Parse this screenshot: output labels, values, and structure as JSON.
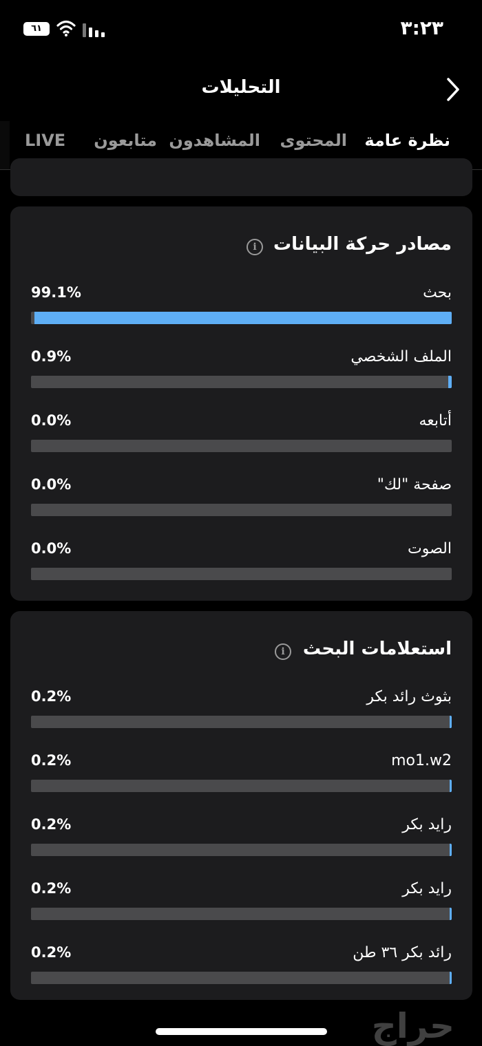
{
  "status_bar": {
    "time": "٣:٢٣",
    "battery_level": "٦١"
  },
  "header": {
    "title": "التحليلات"
  },
  "tabs": [
    {
      "label": "نظرة عامة",
      "active": true
    },
    {
      "label": "المحتوى",
      "active": false
    },
    {
      "label": "المشاهدون",
      "active": false
    },
    {
      "label": "متابعون",
      "active": false
    },
    {
      "label": "LIVE",
      "active": false
    }
  ],
  "traffic_sources": {
    "title": "مصادر حركة البيانات",
    "rows": [
      {
        "label": "بحث",
        "percent_text": "99.1%",
        "value": 99.1
      },
      {
        "label": "الملف الشخصي",
        "percent_text": "0.9%",
        "value": 0.9
      },
      {
        "label": "أتابعه",
        "percent_text": "0.0%",
        "value": 0.0
      },
      {
        "label": "صفحة \"لك\"",
        "percent_text": "0.0%",
        "value": 0.0
      },
      {
        "label": "الصوت",
        "percent_text": "0.0%",
        "value": 0.0
      }
    ]
  },
  "search_queries": {
    "title": "استعلامات البحث",
    "rows": [
      {
        "label": "بثوث رائد بكر",
        "percent_text": "0.2%",
        "value": 0.2
      },
      {
        "label": "mo1.w2",
        "percent_text": "0.2%",
        "value": 0.2
      },
      {
        "label": "رايد بكر",
        "percent_text": "0.2%",
        "value": 0.2
      },
      {
        "label": "رايد بكر",
        "percent_text": "0.2%",
        "value": 0.2
      },
      {
        "label": "رائد بكر ٣٦ طن",
        "percent_text": "0.2%",
        "value": 0.2
      }
    ]
  },
  "watermark": "حراج",
  "colors": {
    "accent": "#5eaef5",
    "card": "#1c1c1e",
    "track": "#4a4a4c"
  }
}
